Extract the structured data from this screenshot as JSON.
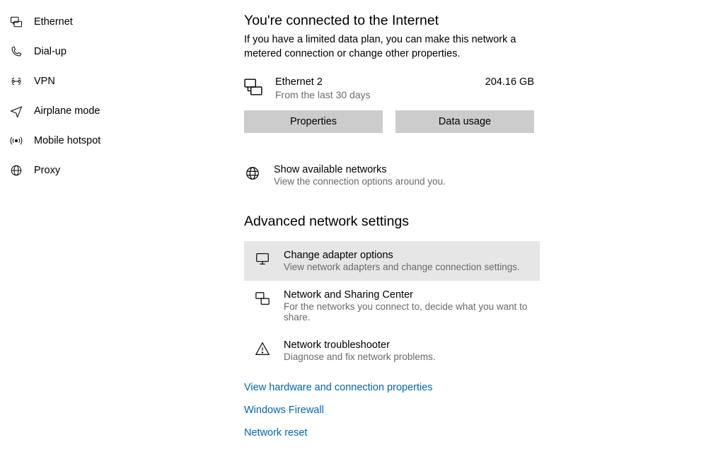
{
  "sidebar": {
    "items": [
      {
        "label": "Ethernet"
      },
      {
        "label": "Dial-up"
      },
      {
        "label": "VPN"
      },
      {
        "label": "Airplane mode"
      },
      {
        "label": "Mobile hotspot"
      },
      {
        "label": "Proxy"
      }
    ]
  },
  "main": {
    "heading": "You're connected to the Internet",
    "sub": "If you have a limited data plan, you can make this network a metered connection or change other properties.",
    "connection": {
      "name": "Ethernet 2",
      "sub": "From the last 30 days",
      "usage": "204.16 GB"
    },
    "buttons": {
      "properties": "Properties",
      "data_usage": "Data usage"
    },
    "show_networks": {
      "title": "Show available networks",
      "sub": "View the connection options around you."
    },
    "advanced_heading": "Advanced network settings",
    "advanced": [
      {
        "title": "Change adapter options",
        "sub": "View network adapters and change connection settings."
      },
      {
        "title": "Network and Sharing Center",
        "sub": "For the networks you connect to, decide what you want to share."
      },
      {
        "title": "Network troubleshooter",
        "sub": "Diagnose and fix network problems."
      }
    ],
    "links": [
      "View hardware and connection properties",
      "Windows Firewall",
      "Network reset"
    ]
  }
}
